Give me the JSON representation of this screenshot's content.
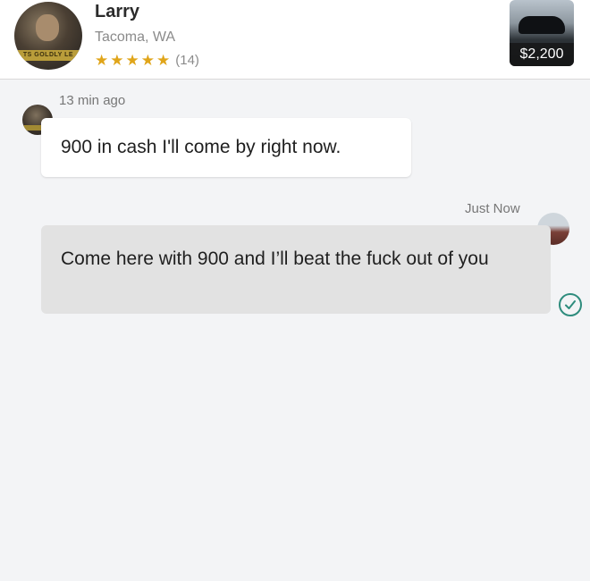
{
  "seller": {
    "name": "Larry",
    "location": "Tacoma, WA",
    "stars": 5,
    "review_count": "(14)",
    "avatar_badge": "TS GOLDLY LE"
  },
  "listing": {
    "price": "$2,200"
  },
  "messages": [
    {
      "direction": "incoming",
      "time": "13 min ago",
      "text": "900 in cash I'll come by right now."
    },
    {
      "direction": "outgoing",
      "time": "Just Now",
      "text": "Come here with 900 and I’ll beat the fuck out of you",
      "status": "delivered"
    }
  ],
  "colors": {
    "star": "#e0a51a",
    "outgoing_bubble": "#e2e2e2",
    "incoming_bubble": "#ffffff",
    "check": "#2e8c7d",
    "background": "#f3f4f6"
  },
  "icons": {
    "rating": "star-icon",
    "delivered": "check-circle-icon"
  }
}
